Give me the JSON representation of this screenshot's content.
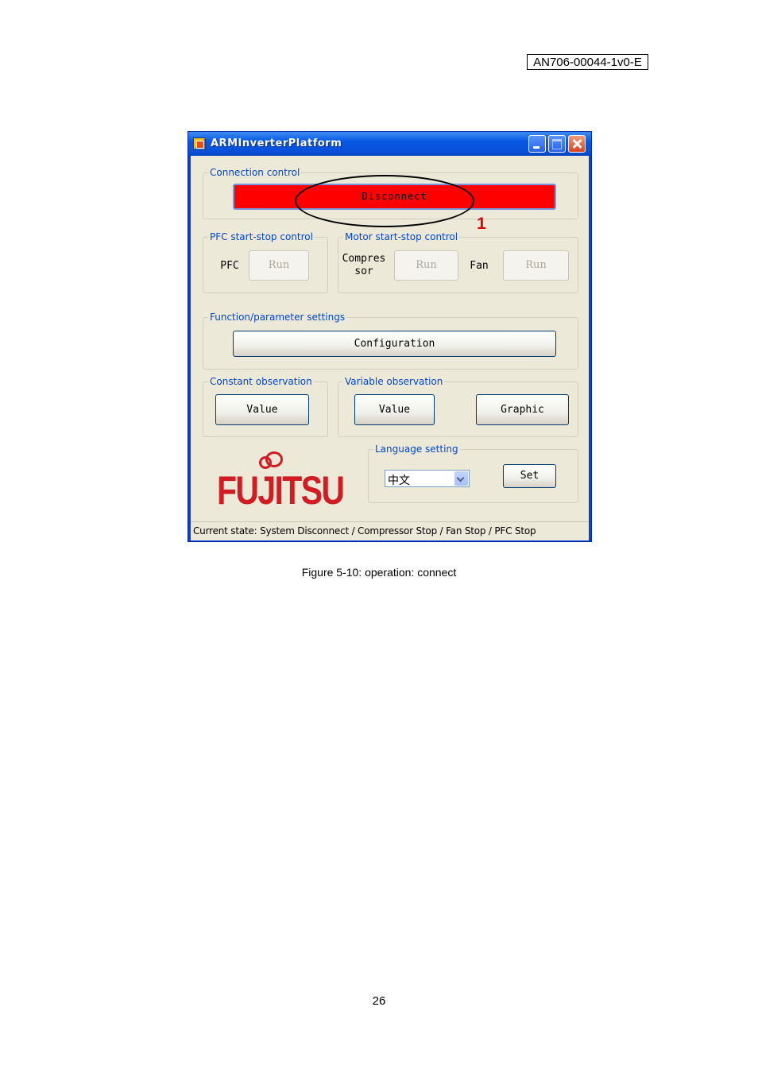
{
  "document": {
    "doc_id": "AN706-00044-1v0-E",
    "caption": "Figure 5-10: operation: connect",
    "page_number": "26"
  },
  "window": {
    "title": "ARMInverterPlatform",
    "connection_group": {
      "label": "Connection control",
      "button_label": "Disconnect"
    },
    "pfc_group": {
      "label": "PFC start-stop control",
      "pfc_label": "PFC",
      "run_label": "Run"
    },
    "motor_group": {
      "label": "Motor start-stop control",
      "compressor_label_line1": "Compres",
      "compressor_label_line2": "sor",
      "compressor_run_label": "Run",
      "fan_label": "Fan",
      "fan_run_label": "Run"
    },
    "function_group": {
      "label": "Function/parameter settings",
      "button_label": "Configuration"
    },
    "constant_group": {
      "label": "Constant observation",
      "button_label": "Value"
    },
    "variable_group": {
      "label": "Variable observation",
      "value_label": "Value",
      "graphic_label": "Graphic"
    },
    "language_group": {
      "label": "Language setting",
      "selected": "中文",
      "set_label": "Set"
    },
    "logo_text": "FUJITSU",
    "status_text": "Current state: System Disconnect / Compressor Stop / Fan Stop / PFC Stop"
  },
  "annotation": {
    "number": "1"
  },
  "colors": {
    "disconnect_bg": "#ff0000",
    "group_label": "#0046d5",
    "logo": "#d01c22",
    "callout": "#e30000"
  }
}
